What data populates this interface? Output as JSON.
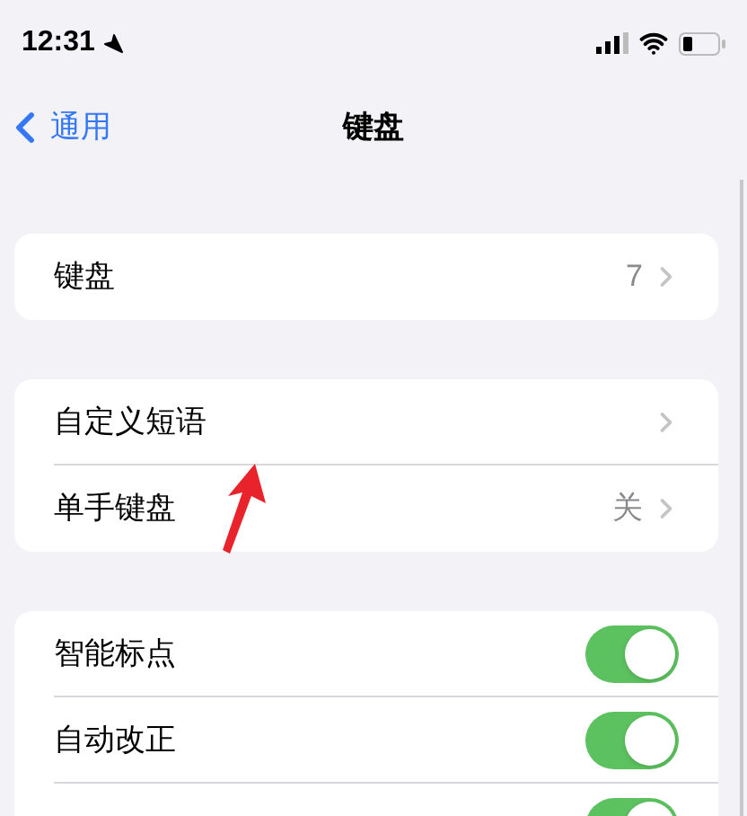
{
  "status_bar": {
    "time": "12:31"
  },
  "nav": {
    "back": "通用",
    "title": "键盘"
  },
  "groups": [
    {
      "rows": [
        {
          "kind": "link",
          "label": "键盘",
          "value": "7"
        }
      ]
    },
    {
      "rows": [
        {
          "kind": "link",
          "label": "自定义短语"
        },
        {
          "kind": "link",
          "label": "单手键盘",
          "value": "关"
        }
      ]
    },
    {
      "rows": [
        {
          "kind": "toggle",
          "label": "智能标点",
          "on": true
        },
        {
          "kind": "toggle",
          "label": "自动改正",
          "on": true
        },
        {
          "kind": "toggle",
          "on": true
        }
      ]
    }
  ]
}
